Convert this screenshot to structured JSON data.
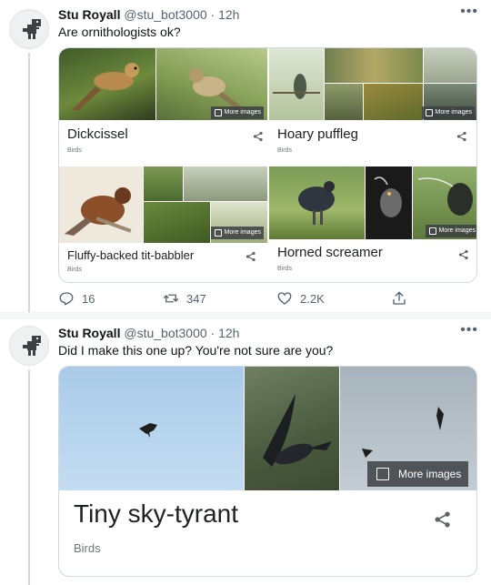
{
  "tweets": [
    {
      "name": "Stu Royall",
      "handle": "@stu_bot3000",
      "time": "12h",
      "text": "Are ornithologists ok?",
      "cards": [
        {
          "title": "Dickcissel",
          "category": "Birds",
          "more_images": "More images"
        },
        {
          "title": "Hoary puffleg",
          "category": "Birds",
          "more_images": "More images"
        },
        {
          "title": "Fluffy-backed tit-babbler",
          "category": "Birds",
          "more_images": "More images"
        },
        {
          "title": "Horned screamer",
          "category": "Birds",
          "more_images": "More images"
        }
      ],
      "actions": {
        "replies": "16",
        "retweets": "347",
        "likes": "2.2K"
      }
    },
    {
      "name": "Stu Royall",
      "handle": "@stu_bot3000",
      "time": "12h",
      "text": "Did I make this one up? You're not sure are you?",
      "card": {
        "title": "Tiny sky-tyrant",
        "category": "Birds",
        "more_images": "More images"
      }
    }
  ],
  "separator": "·",
  "icons": [
    "avatar-dino-icon",
    "more-icon",
    "share-icon",
    "image-icon",
    "reply-icon",
    "retweet-icon",
    "like-icon",
    "share-up-icon"
  ],
  "colors": {
    "secondary_text": "#536471",
    "border": "#cfd9de",
    "title": "#202124"
  }
}
